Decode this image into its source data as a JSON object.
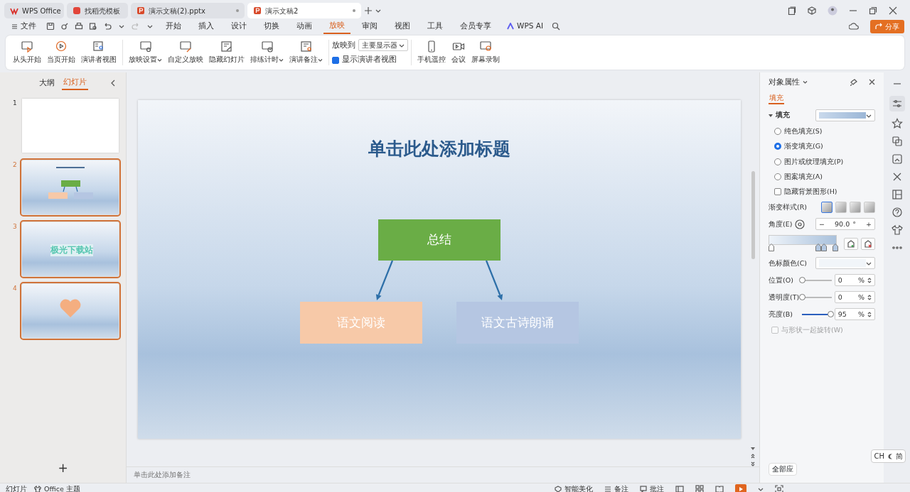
{
  "tabs": [
    {
      "label": "WPS Office",
      "selected": false
    },
    {
      "label": "找稻壳模板",
      "selected": false
    },
    {
      "label": "演示文稿(2).pptx",
      "selected": false
    },
    {
      "label": "演示文稿2",
      "selected": true
    }
  ],
  "menu": {
    "file": "文件",
    "items": [
      {
        "label": "开始",
        "selected": false
      },
      {
        "label": "插入",
        "selected": false
      },
      {
        "label": "设计",
        "selected": false
      },
      {
        "label": "切换",
        "selected": false
      },
      {
        "label": "动画",
        "selected": false
      },
      {
        "label": "放映",
        "selected": true
      },
      {
        "label": "审阅",
        "selected": false
      },
      {
        "label": "视图",
        "selected": false
      },
      {
        "label": "工具",
        "selected": false
      },
      {
        "label": "会员专享",
        "selected": false
      }
    ],
    "ai": "WPS AI",
    "share": "分享"
  },
  "ribbon": {
    "groups": [
      [
        {
          "label": "从头开始",
          "dropdown": false
        },
        {
          "label": "当页开始",
          "dropdown": false
        },
        {
          "label": "演讲者视图",
          "dropdown": false
        }
      ],
      [
        {
          "label": "放映设置",
          "dropdown": true
        },
        {
          "label": "自定义放映",
          "dropdown": false
        },
        {
          "label": "隐藏幻灯片",
          "dropdown": false
        },
        {
          "label": "排练计时",
          "dropdown": true
        },
        {
          "label": "演讲备注",
          "dropdown": true
        }
      ]
    ],
    "play_to": {
      "label": "放映到",
      "value": "主要显示器"
    },
    "presenter_view": {
      "label": "显示演讲者视图",
      "checked": true
    },
    "tools": [
      {
        "label": "手机遥控"
      },
      {
        "label": "会议"
      },
      {
        "label": "屏幕录制"
      }
    ]
  },
  "slide_panel": {
    "tabs": [
      {
        "label": "大纲",
        "selected": false
      },
      {
        "label": "幻灯片",
        "selected": true
      }
    ],
    "slides": [
      {
        "number": "1",
        "kind": "blank",
        "selected": false
      },
      {
        "number": "2",
        "kind": "diagram",
        "selected": true
      },
      {
        "number": "3",
        "kind": "text",
        "text": "极光下载站",
        "selected": true
      },
      {
        "number": "4",
        "kind": "heart",
        "selected": true
      }
    ],
    "add": "+"
  },
  "slide": {
    "title": "单击此处添加标题",
    "nodes": [
      {
        "text": "总结",
        "color": "#6aad46"
      },
      {
        "text": "语文阅读",
        "color": "#f7c9a8"
      },
      {
        "text": "语文古诗朗诵",
        "color": "#b5c6e2"
      }
    ]
  },
  "notes": {
    "placeholder": "单击此处添加备注"
  },
  "properties": {
    "title": "对象属性",
    "tab": "填充",
    "section": "填充",
    "options": [
      {
        "label": "纯色填充(S)",
        "selected": false
      },
      {
        "label": "渐变填充(G)",
        "selected": true
      },
      {
        "label": "图片或纹理填充(P)",
        "selected": false
      },
      {
        "label": "图案填充(A)",
        "selected": false
      }
    ],
    "hide_background": {
      "label": "隐藏背景图形(H)",
      "checked": false
    },
    "gradient_style": {
      "label": "渐变样式(R)",
      "styles": [
        {
          "selected": true
        },
        {
          "selected": false
        },
        {
          "selected": false
        },
        {
          "selected": false
        }
      ]
    },
    "angle": {
      "label": "角度(E)",
      "value": "90.0",
      "unit": "°",
      "minus": "−",
      "plus": "+"
    },
    "stops": [
      {
        "level": 0
      },
      {
        "level": 0.72
      },
      {
        "level": 0.8
      },
      {
        "level": 0.98
      }
    ],
    "stop_color": {
      "label": "色标颜色(C)"
    },
    "sliders": [
      {
        "label": "位置(O)",
        "level": 0,
        "value": "0",
        "unit": "%"
      },
      {
        "label": "透明度(T)",
        "level": 0,
        "value": "0",
        "unit": "%"
      },
      {
        "label": "亮度(B)",
        "level": 0.95,
        "value": "95",
        "unit": "%"
      }
    ],
    "rotate": {
      "label": "与形状一起旋转(W)",
      "checked": false,
      "disabled": true
    },
    "apply_all": "全部应"
  },
  "ime": {
    "mode": "CH",
    "script": "简"
  },
  "status_bar": {
    "slides": "幻灯片",
    "theme": "Office 主题",
    "beautify": "智能美化",
    "notes": "备注",
    "comments": "批注"
  }
}
